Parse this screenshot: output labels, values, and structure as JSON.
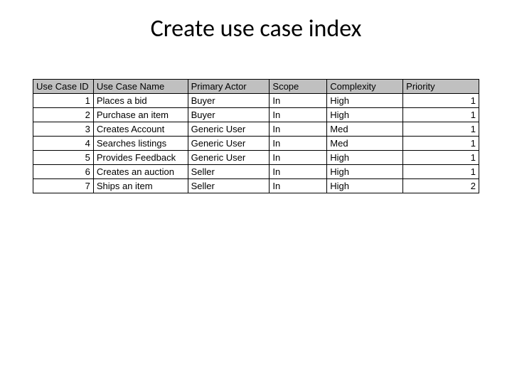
{
  "title": "Create use case index",
  "headers": {
    "id": "Use Case ID",
    "name": "Use Case Name",
    "actor": "Primary Actor",
    "scope": "Scope",
    "complexity": "Complexity",
    "priority": "Priority"
  },
  "rows": [
    {
      "id": "1",
      "name": "Places a bid",
      "actor": "Buyer",
      "scope": "In",
      "complexity": "High",
      "priority": "1"
    },
    {
      "id": "2",
      "name": "Purchase an item",
      "actor": "Buyer",
      "scope": "In",
      "complexity": "High",
      "priority": "1"
    },
    {
      "id": "3",
      "name": "Creates Account",
      "actor": "Generic User",
      "scope": "In",
      "complexity": "Med",
      "priority": "1"
    },
    {
      "id": "4",
      "name": "Searches listings",
      "actor": "Generic User",
      "scope": "In",
      "complexity": "Med",
      "priority": "1"
    },
    {
      "id": "5",
      "name": "Provides Feedback",
      "actor": "Generic User",
      "scope": "In",
      "complexity": "High",
      "priority": "1"
    },
    {
      "id": "6",
      "name": "Creates an auction",
      "actor": "Seller",
      "scope": "In",
      "complexity": "High",
      "priority": "1"
    },
    {
      "id": "7",
      "name": "Ships an item",
      "actor": "Seller",
      "scope": "In",
      "complexity": "High",
      "priority": "2"
    }
  ],
  "chart_data": {
    "type": "table",
    "title": "Create use case index",
    "columns": [
      "Use Case ID",
      "Use Case Name",
      "Primary Actor",
      "Scope",
      "Complexity",
      "Priority"
    ],
    "rows": [
      [
        1,
        "Places a bid",
        "Buyer",
        "In",
        "High",
        1
      ],
      [
        2,
        "Purchase an item",
        "Buyer",
        "In",
        "High",
        1
      ],
      [
        3,
        "Creates Account",
        "Generic User",
        "In",
        "Med",
        1
      ],
      [
        4,
        "Searches listings",
        "Generic User",
        "In",
        "Med",
        1
      ],
      [
        5,
        "Provides Feedback",
        "Generic User",
        "In",
        "High",
        1
      ],
      [
        6,
        "Creates an auction",
        "Seller",
        "In",
        "High",
        1
      ],
      [
        7,
        "Ships an item",
        "Seller",
        "In",
        "High",
        2
      ]
    ]
  }
}
